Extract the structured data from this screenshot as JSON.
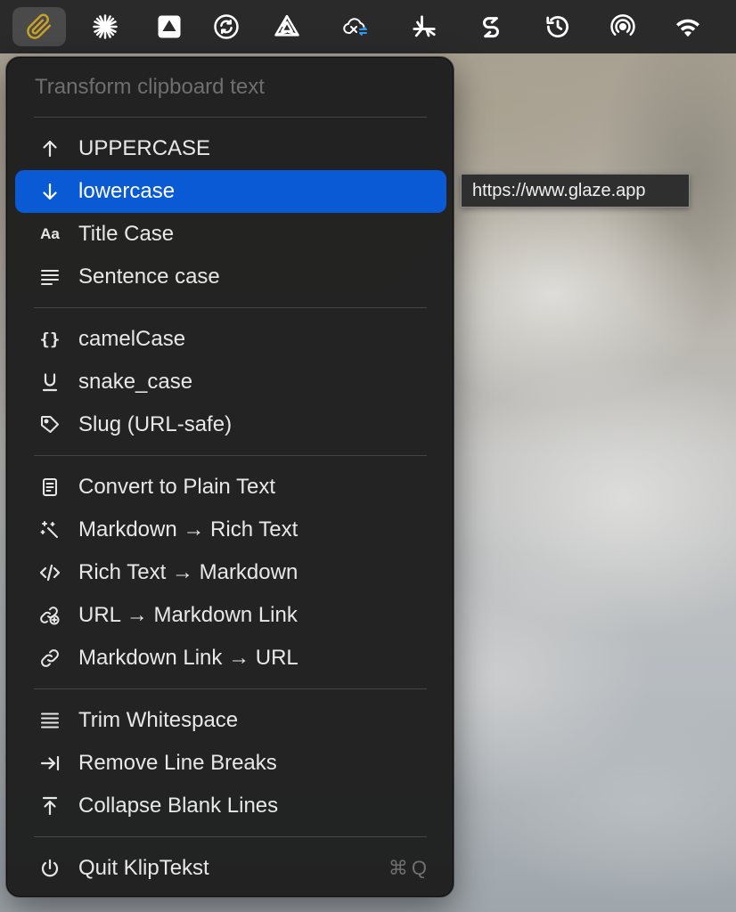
{
  "menubar": {
    "icons": [
      {
        "name": "paperclip-icon",
        "active": true
      },
      {
        "name": "starburst-icon"
      },
      {
        "name": "drive-triangle-icon"
      },
      {
        "name": "sync-circle-icon"
      },
      {
        "name": "triangle-swirl-icon"
      },
      {
        "name": "cloud-sync-icon"
      },
      {
        "name": "fan-icon"
      },
      {
        "name": "s-logo-icon"
      },
      {
        "name": "time-machine-icon"
      },
      {
        "name": "airdrop-icon"
      },
      {
        "name": "wifi-icon"
      }
    ]
  },
  "menu": {
    "title": "Transform clipboard text",
    "items": [
      {
        "icon": "arrow-up-icon",
        "label": "UPPERCASE"
      },
      {
        "icon": "arrow-down-icon",
        "label": "lowercase",
        "selected": true
      },
      {
        "icon": "text-case-icon",
        "icon_text": "Aa",
        "label": "Title Case"
      },
      {
        "icon": "text-align-left-icon",
        "label": "Sentence case"
      },
      {
        "icon": "curly-braces-icon",
        "icon_text": "{}",
        "label": "camelCase"
      },
      {
        "icon": "underline-icon",
        "label": "snake_case"
      },
      {
        "icon": "tag-icon",
        "label": "Slug (URL-safe)"
      },
      {
        "icon": "document-icon",
        "label": "Convert to Plain Text"
      },
      {
        "icon": "magic-wand-icon",
        "label": "Markdown → Rich Text"
      },
      {
        "icon": "code-icon",
        "label": "Rich Text → Markdown"
      },
      {
        "icon": "link-add-icon",
        "label": "URL → Markdown Link"
      },
      {
        "icon": "link-icon",
        "label": "Markdown Link → URL"
      },
      {
        "icon": "lines-icon",
        "label": "Trim Whitespace"
      },
      {
        "icon": "arrow-to-right-icon",
        "label": "Remove Line Breaks"
      },
      {
        "icon": "arrow-to-top-icon",
        "label": "Collapse Blank Lines"
      },
      {
        "icon": "power-icon",
        "label": "Quit KlipTekst",
        "shortcut": "⌘Q"
      }
    ]
  },
  "tooltip": {
    "text": "https://www.glaze.app"
  }
}
